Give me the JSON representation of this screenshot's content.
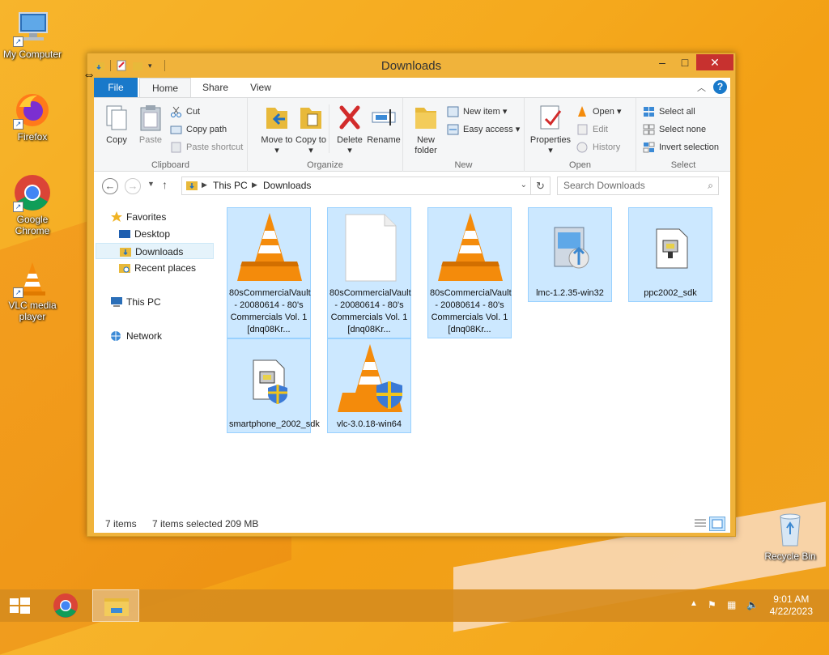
{
  "desktop": {
    "icons": [
      {
        "label": "My Computer",
        "icon": "computer-icon"
      },
      {
        "label": "Firefox",
        "icon": "firefox-icon"
      },
      {
        "label": "Google Chrome",
        "icon": "chrome-icon"
      },
      {
        "label": "VLC media player",
        "icon": "vlc-icon"
      },
      {
        "label": "Recycle Bin",
        "icon": "recycle-bin-icon"
      }
    ]
  },
  "window": {
    "title": "Downloads",
    "tabs": [
      "File",
      "Home",
      "Share",
      "View"
    ],
    "ribbon": {
      "clipboard": {
        "label": "Clipboard",
        "copy": "Copy",
        "paste": "Paste",
        "cut": "Cut",
        "copy_path": "Copy path",
        "paste_shortcut": "Paste shortcut"
      },
      "organize": {
        "label": "Organize",
        "move_to": "Move to",
        "copy_to": "Copy to",
        "delete": "Delete",
        "rename": "Rename"
      },
      "new": {
        "label": "New",
        "new_folder": "New folder",
        "new_item": "New item",
        "easy_access": "Easy access"
      },
      "open": {
        "label": "Open",
        "properties": "Properties",
        "open": "Open",
        "edit": "Edit",
        "history": "History"
      },
      "select": {
        "label": "Select",
        "select_all": "Select all",
        "select_none": "Select none",
        "invert": "Invert selection"
      }
    },
    "address": {
      "crumbs": [
        "This PC",
        "Downloads"
      ]
    },
    "search_placeholder": "Search Downloads",
    "nav_pane": {
      "favorites": "Favorites",
      "desktop": "Desktop",
      "downloads": "Downloads",
      "recent": "Recent places",
      "this_pc": "This PC",
      "network": "Network"
    },
    "files": [
      {
        "name": "80sCommercialVault - 20080614 - 80's Commercials Vol. 1 [dnq08Kr...",
        "type": "vlc"
      },
      {
        "name": "80sCommercialVault - 20080614 - 80's Commercials Vol. 1 [dnq08Kr...",
        "type": "blank"
      },
      {
        "name": "80sCommercialVault - 20080614 - 80's Commercials Vol. 1 [dnq08Kr...",
        "type": "vlc"
      },
      {
        "name": "lmc-1.2.35-win32",
        "type": "installer"
      },
      {
        "name": "ppc2002_sdk",
        "type": "setup"
      },
      {
        "name": "smartphone_2002_sdk",
        "type": "setup-shield"
      },
      {
        "name": "vlc-3.0.18-win64",
        "type": "vlc-shield"
      }
    ],
    "status": {
      "items": "7 items",
      "selected": "7 items selected",
      "size": "209 MB"
    }
  },
  "taskbar": {
    "time": "9:01 AM",
    "date": "4/22/2023"
  }
}
